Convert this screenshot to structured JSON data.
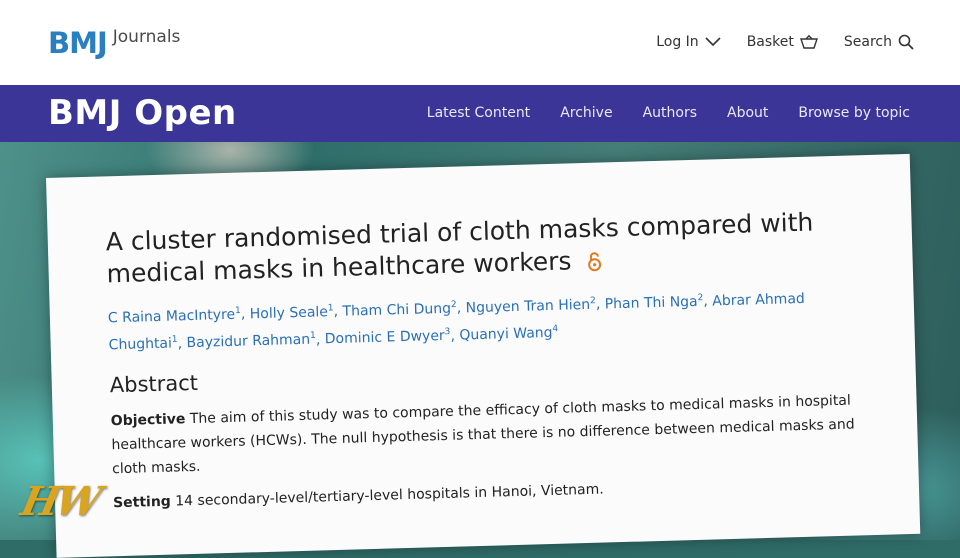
{
  "header": {
    "logo_main": "BMJ",
    "logo_sub": "Journals",
    "nav": [
      {
        "label": "Log In",
        "icon": "chevron-down-icon"
      },
      {
        "label": "Basket",
        "icon": "basket-icon"
      },
      {
        "label": "Search",
        "icon": "search-icon"
      }
    ]
  },
  "band": {
    "title": "BMJ Open",
    "nav": [
      "Latest Content",
      "Archive",
      "Authors",
      "About",
      "Browse by topic"
    ]
  },
  "article": {
    "title_line1": "A cluster randomised trial of cloth masks compared with",
    "title_line2": "medical masks in healthcare workers",
    "open_access_icon": "open-access-icon",
    "authors": [
      {
        "name": "C Raina MacIntyre",
        "sup": "1"
      },
      {
        "name": "Holly Seale",
        "sup": "1"
      },
      {
        "name": "Tham Chi Dung",
        "sup": "2"
      },
      {
        "name": "Nguyen Tran Hien",
        "sup": "2"
      },
      {
        "name": "Phan Thi Nga",
        "sup": "2"
      },
      {
        "name": "Abrar Ahmad Chughtai",
        "sup": "1"
      },
      {
        "name": "Bayzidur Rahman",
        "sup": "1"
      },
      {
        "name": "Dominic E Dwyer",
        "sup": "3"
      },
      {
        "name": "Quanyi Wang",
        "sup": "4"
      }
    ],
    "abstract_heading": "Abstract",
    "objective_label": "Objective",
    "objective_text": "The aim of this study was to compare the efficacy of cloth masks to medical masks in hospital healthcare workers (HCWs). The null hypothesis is that there is no difference between medical masks and cloth masks.",
    "setting_label": "Setting",
    "setting_text": "14 secondary-level/tertiary-level hospitals in Hanoi, Vietnam."
  },
  "watermark": "HW",
  "colors": {
    "brand_blue": "#2a7fc1",
    "band_purple": "#3b3597",
    "link_blue": "#2a6fb6",
    "open_access_orange": "#e07a1f"
  }
}
